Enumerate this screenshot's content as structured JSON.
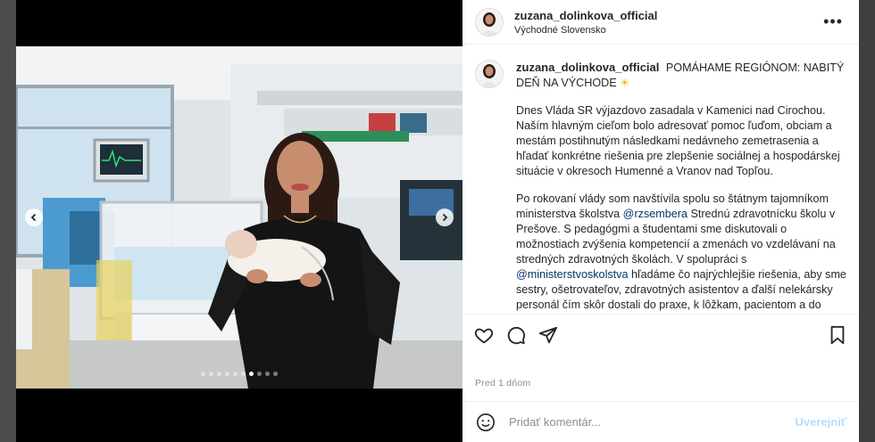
{
  "post": {
    "username": "zuzana_dolinkova_official",
    "location": "Východné Slovensko",
    "more_label": "•••",
    "caption_title": "POMÁHAME REGIÓNOM: NABITÝ DEŇ NA VÝCHODE",
    "caption_emoji": "☀",
    "paragraph1": "Dnes Vláda SR výjazdovo zasadala v Kamenici nad Cirochou. Naším hlavným cieľom bolo adresovať pomoc ľuďom, obciam a mestám postihnutým následkami nedávneho zemetrasenia a hľadať konkrétne riešenia pre zlepšenie sociálnej a hospodárskej situácie v okresoch Humenné a Vranov nad Topľou.",
    "paragraph2_part1": "Po rokovaní vlády som navštívila spolu so štátnym tajomníkom ministerstva školstva ",
    "mention1": "@rzsembera",
    "paragraph2_part2": " Strednú zdravotnícku školu v Prešove. S pedagógmi a študentami sme diskutovali o možnostiach zvýšenia kompetencií a zmenách vo vzdelávaní na stredných zdravotných školách. V spolupráci s ",
    "mention2": "@ministerstvoskolstva",
    "paragraph2_part3": " hľadáme čo najrýchlejšie riešenia, aby sme sestry, ošetrovateľov, zdravotných asistentov a ďalší nelekársky personál čím skôr dostali do praxe, k lôžkam, pacientom a do nemocníc.",
    "timestamp": "Pred 1 dňom",
    "comment_placeholder": "Pridať komentár...",
    "post_button": "Uverejniť"
  },
  "carousel": {
    "total": 10,
    "active_index": 6
  },
  "icons": {
    "like": "heart-icon",
    "comment": "comment-icon",
    "share": "share-icon",
    "save": "bookmark-icon",
    "emoji": "emoji-icon",
    "prev": "chevron-left-icon",
    "next": "chevron-right-icon"
  }
}
